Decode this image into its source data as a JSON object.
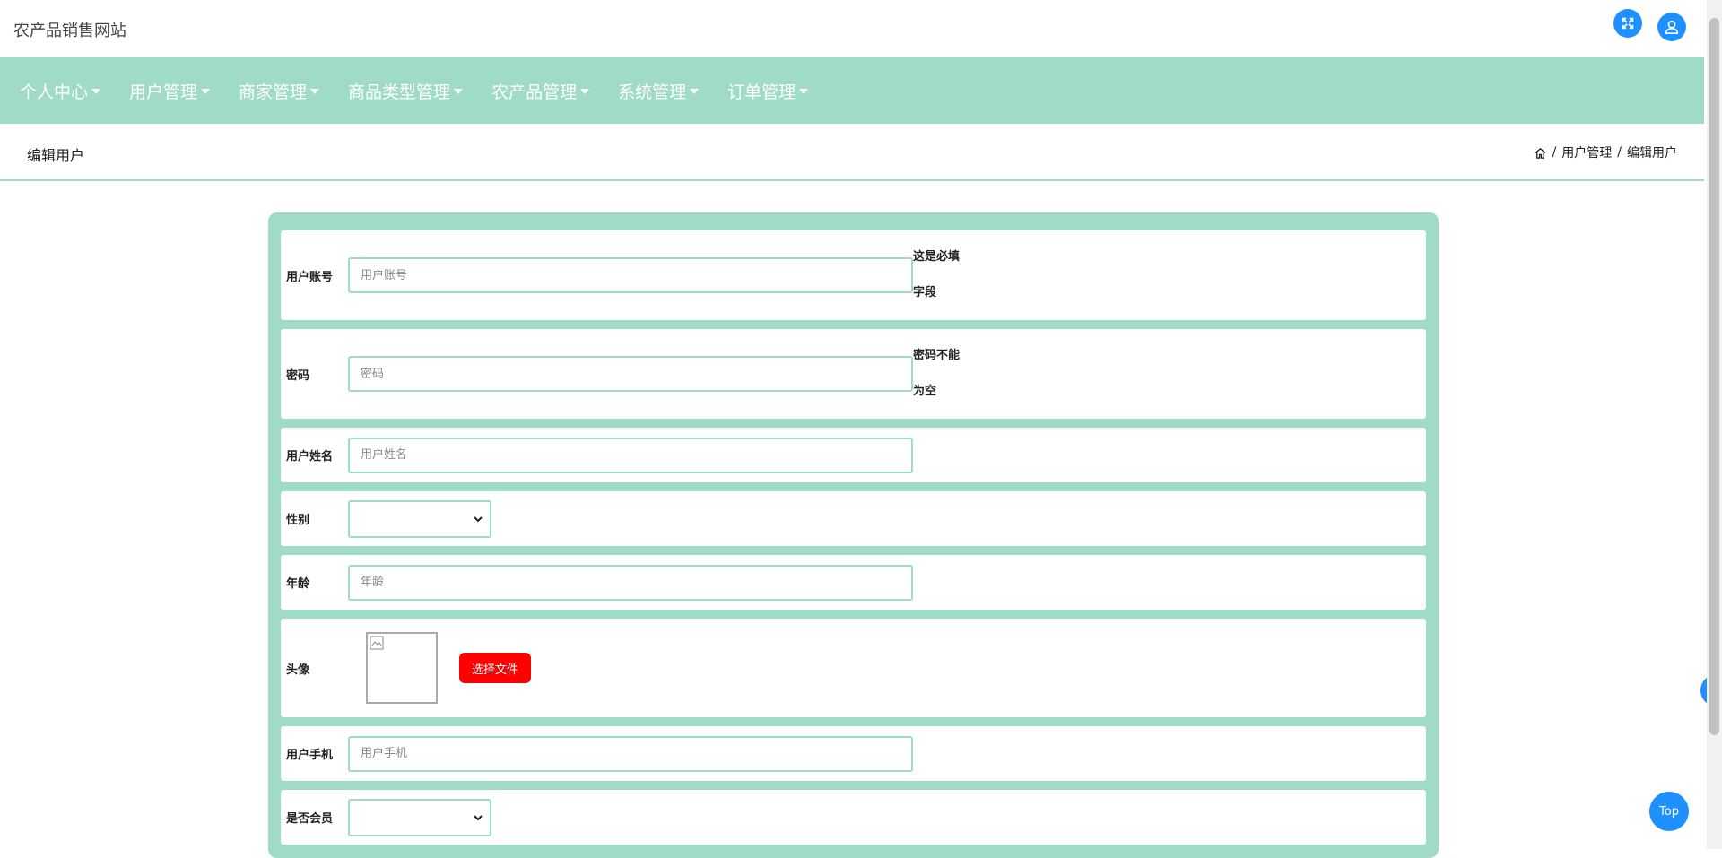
{
  "app": {
    "title": "农产品销售网站"
  },
  "nav": {
    "items": [
      {
        "label": "个人中心"
      },
      {
        "label": "用户管理"
      },
      {
        "label": "商家管理"
      },
      {
        "label": "商品类型管理"
      },
      {
        "label": "农产品管理"
      },
      {
        "label": "系统管理"
      },
      {
        "label": "订单管理"
      }
    ]
  },
  "page": {
    "title": "编辑用户",
    "breadcrumb": {
      "sep": "/",
      "parent": "用户管理",
      "current": "编辑用户"
    }
  },
  "form": {
    "account": {
      "label": "用户账号",
      "placeholder": "用户账号",
      "hint_line1": "这是必填",
      "hint_line2": "字段"
    },
    "password": {
      "label": "密码",
      "placeholder": "密码",
      "hint_line1": "密码不能",
      "hint_line2": "为空"
    },
    "name": {
      "label": "用户姓名",
      "placeholder": "用户姓名"
    },
    "gender": {
      "label": "性别",
      "selected": ""
    },
    "age": {
      "label": "年龄",
      "placeholder": "年龄"
    },
    "avatar": {
      "label": "头像",
      "upload_label": "选择文件"
    },
    "phone": {
      "label": "用户手机",
      "placeholder": "用户手机"
    },
    "member": {
      "label": "是否会员",
      "selected": ""
    }
  },
  "floating": {
    "top_label": "Top"
  },
  "colors": {
    "accent": "#a0dbc6",
    "primary": "#1e90ff",
    "upload": "#ff0000"
  }
}
